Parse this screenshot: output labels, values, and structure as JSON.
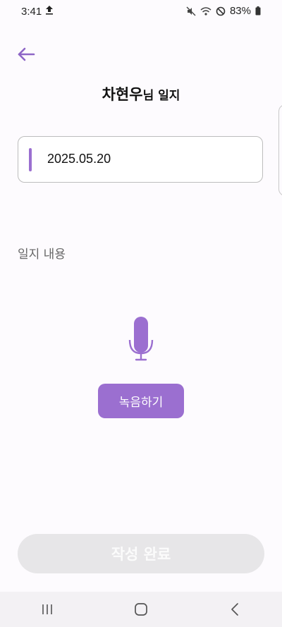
{
  "status_bar": {
    "time": "3:41",
    "battery": "83%",
    "icons": [
      "upload-icon",
      "mute-icon",
      "wifi-icon",
      "do-not-disturb-icon",
      "battery-icon"
    ]
  },
  "header": {
    "back_icon": "arrow-left-icon",
    "title_name": "차현우",
    "title_suffix": "님 일지"
  },
  "date_field": {
    "value": "2025.05.20"
  },
  "content": {
    "label": "일지 내용",
    "mic_icon": "microphone-icon",
    "record_label": "녹음하기"
  },
  "footer": {
    "complete_label": "작성 완료"
  },
  "nav_bar": {
    "items": [
      "recent-apps-icon",
      "home-icon",
      "back-icon"
    ]
  },
  "colors": {
    "accent": "#9b6fd0",
    "background": "#fdfbfe",
    "disabled_button": "#e7e6e8"
  }
}
